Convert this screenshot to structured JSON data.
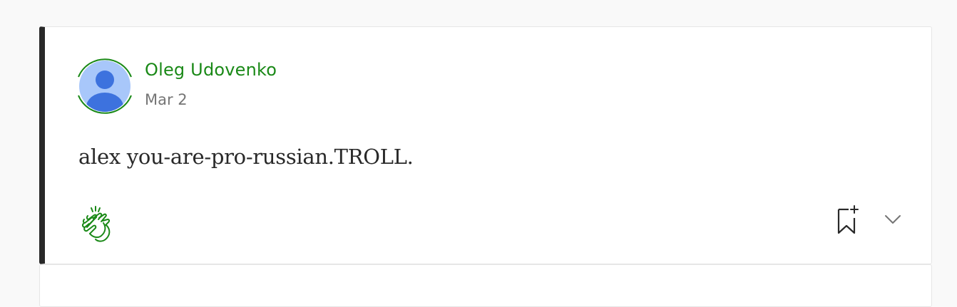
{
  "response": {
    "author_name": "Oleg Udovenko",
    "date": "Mar 2",
    "text": "alex you-are-pro-russian.TROLL.",
    "avatar_icon": "default-user-avatar-icon",
    "actions": {
      "clap_icon": "clap-icon",
      "bookmark_icon": "bookmark-add-icon",
      "more_icon": "chevron-down-icon"
    },
    "colors": {
      "accent": "#1a8917",
      "text": "#292929",
      "muted": "#757575",
      "left_border": "#292929"
    }
  }
}
